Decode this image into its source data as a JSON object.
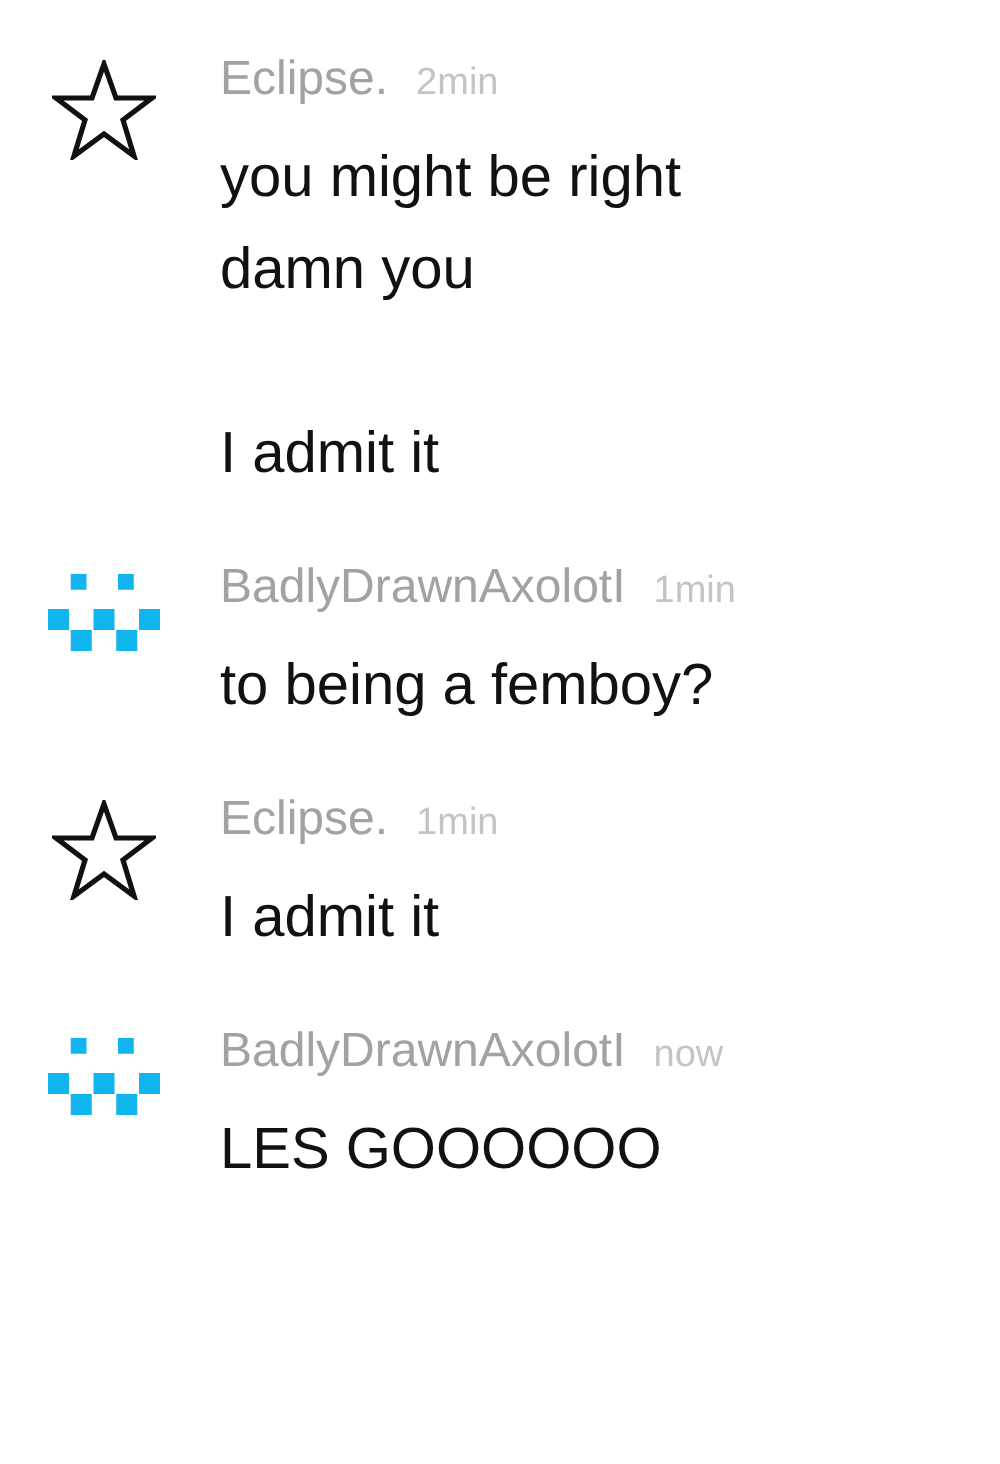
{
  "messages": [
    {
      "author": "Eclipse.",
      "kind": "star",
      "time": "2min",
      "text": "you might be right\ndamn you\n\nI admit it"
    },
    {
      "author": "BadlyDrawnAxolotI",
      "kind": "pixel",
      "time": "1min",
      "text": "to being a femboy?"
    },
    {
      "author": "Eclipse.",
      "kind": "star",
      "time": "1min",
      "text": "I admit it"
    },
    {
      "author": "BadlyDrawnAxolotI",
      "kind": "pixel",
      "time": "now",
      "text": "LES GOOOOOO"
    }
  ]
}
